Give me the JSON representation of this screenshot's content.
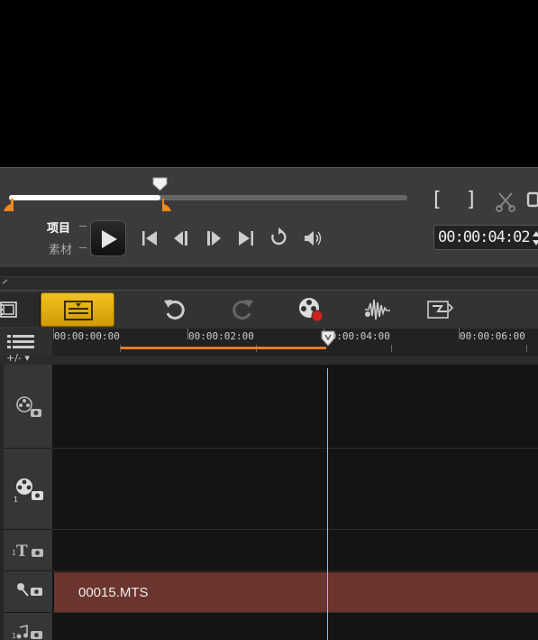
{
  "player": {
    "mode_project": "项目",
    "mode_clip": "素材",
    "bracket_in": "[",
    "bracket_out": "]",
    "timecode": "00:00:04:02",
    "scrub_progress": 0.38
  },
  "timeline": {
    "ruler_ticks": [
      "00:00:00:00",
      "00:00:02:00",
      "00:00:04:00",
      "00:00:06:00"
    ],
    "zoom_label": "+/- ▾",
    "clip_name": "00015.MTS"
  },
  "colors": {
    "accent_orange": "#e87a1c",
    "timeline_button": "#f3c21d",
    "clip_fill": "#6b342e",
    "playhead": "#8cc4f0"
  },
  "icons": {
    "storyboard": "filmstrip-icon",
    "timeline": "timeline-view-icon",
    "undo": "undo-icon",
    "redo": "redo-icon",
    "record": "record-capture-icon",
    "audio_mix": "sound-mixer-icon",
    "auto_music": "auto-music-icon",
    "video_track": "video-track-icon",
    "overlay_track": "overlay-track-icon",
    "title_track": "title-track-icon",
    "voice_track": "voice-track-icon",
    "music_track": "music-track-icon"
  }
}
